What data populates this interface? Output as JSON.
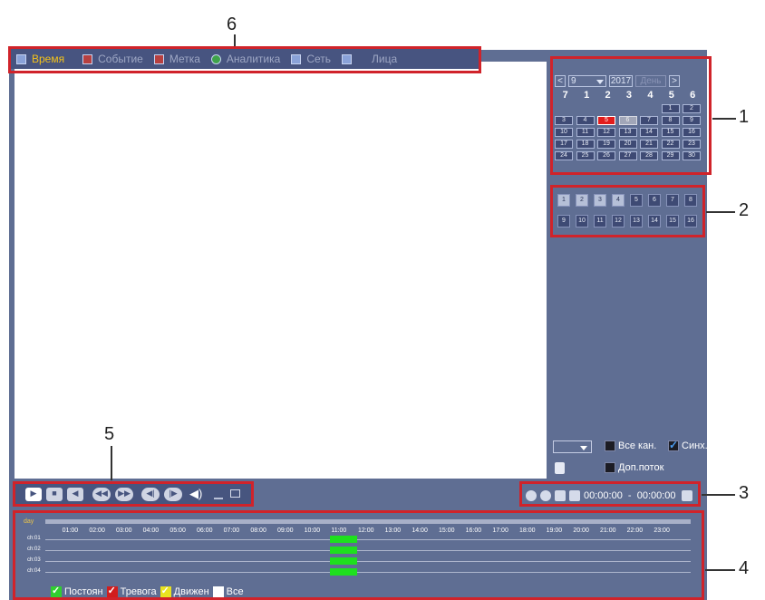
{
  "callouts": [
    "1",
    "2",
    "3",
    "4",
    "5",
    "6"
  ],
  "tabs": [
    {
      "label": "Время",
      "icon": "clock-icon"
    },
    {
      "label": "Событие",
      "icon": "event-icon"
    },
    {
      "label": "Метка",
      "icon": "tag-icon"
    },
    {
      "label": "Аналитика",
      "icon": "analytics-icon"
    },
    {
      "label": "Сеть",
      "icon": "network-icon"
    },
    {
      "label": "Лица",
      "icon": "face-icon"
    }
  ],
  "calendar": {
    "prev": "<",
    "next": ">",
    "month": "9",
    "year": "2017",
    "view": "День",
    "weekdays": [
      "7",
      "1",
      "2",
      "3",
      "4",
      "5",
      "6"
    ],
    "days": [
      {
        "d": "",
        "s": "empty"
      },
      {
        "d": "",
        "s": "empty"
      },
      {
        "d": "",
        "s": "empty"
      },
      {
        "d": "",
        "s": "empty"
      },
      {
        "d": "",
        "s": "empty"
      },
      {
        "d": "1",
        "s": ""
      },
      {
        "d": "2",
        "s": ""
      },
      {
        "d": "3",
        "s": ""
      },
      {
        "d": "4",
        "s": ""
      },
      {
        "d": "5",
        "s": "rec"
      },
      {
        "d": "6",
        "s": "sel"
      },
      {
        "d": "7",
        "s": ""
      },
      {
        "d": "8",
        "s": ""
      },
      {
        "d": "9",
        "s": ""
      },
      {
        "d": "10",
        "s": ""
      },
      {
        "d": "11",
        "s": ""
      },
      {
        "d": "12",
        "s": ""
      },
      {
        "d": "13",
        "s": ""
      },
      {
        "d": "14",
        "s": ""
      },
      {
        "d": "15",
        "s": ""
      },
      {
        "d": "16",
        "s": ""
      },
      {
        "d": "17",
        "s": ""
      },
      {
        "d": "18",
        "s": ""
      },
      {
        "d": "19",
        "s": ""
      },
      {
        "d": "20",
        "s": ""
      },
      {
        "d": "21",
        "s": ""
      },
      {
        "d": "22",
        "s": ""
      },
      {
        "d": "23",
        "s": ""
      },
      {
        "d": "24",
        "s": ""
      },
      {
        "d": "25",
        "s": ""
      },
      {
        "d": "26",
        "s": ""
      },
      {
        "d": "27",
        "s": ""
      },
      {
        "d": "28",
        "s": ""
      },
      {
        "d": "29",
        "s": ""
      },
      {
        "d": "30",
        "s": ""
      }
    ]
  },
  "channels": [
    {
      "n": "1",
      "on": true
    },
    {
      "n": "2",
      "on": true
    },
    {
      "n": "3",
      "on": true
    },
    {
      "n": "4",
      "on": true
    },
    {
      "n": "5",
      "on": false
    },
    {
      "n": "6",
      "on": false
    },
    {
      "n": "7",
      "on": false
    },
    {
      "n": "8",
      "on": false
    },
    {
      "n": "9",
      "on": false
    },
    {
      "n": "10",
      "on": false
    },
    {
      "n": "11",
      "on": false
    },
    {
      "n": "12",
      "on": false
    },
    {
      "n": "13",
      "on": false
    },
    {
      "n": "14",
      "on": false
    },
    {
      "n": "15",
      "on": false
    },
    {
      "n": "16",
      "on": false
    }
  ],
  "options": {
    "all_channels": "Все кан.",
    "sync": "Синх.",
    "sync_checked": true,
    "substream": "Доп.поток"
  },
  "time_range": "00:00:00  -  00:00:00",
  "timeline": {
    "scale_label": "day",
    "hours": [
      "01:00",
      "02:00",
      "03:00",
      "04:00",
      "05:00",
      "06:00",
      "07:00",
      "08:00",
      "09:00",
      "10:00",
      "11:00",
      "12:00",
      "13:00",
      "14:00",
      "15:00",
      "16:00",
      "17:00",
      "18:00",
      "19:00",
      "20:00",
      "21:00",
      "22:00",
      "23:00"
    ],
    "channels": [
      "ch:01",
      "ch:02",
      "ch:03",
      "ch:04"
    ],
    "record_start_hour": 10.6,
    "record_end_hour": 11.6,
    "record_color": "#1ee01e"
  },
  "legend": [
    {
      "label": "Постоян",
      "color": "#2fcf2f"
    },
    {
      "label": "Тревога",
      "color": "#d11d1d"
    },
    {
      "label": "Движен",
      "color": "#e9e21f"
    },
    {
      "label": "Все",
      "color": "#ffffff"
    }
  ]
}
